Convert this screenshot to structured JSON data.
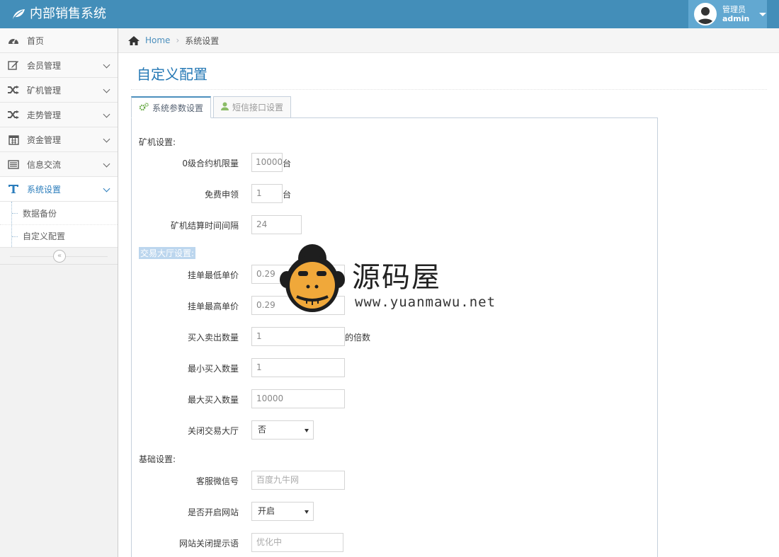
{
  "app": {
    "title": "内部销售系统"
  },
  "user": {
    "role": "管理员",
    "name": "admin"
  },
  "sidebar": {
    "items": [
      {
        "label": "首页",
        "icon": "dashboard-icon"
      },
      {
        "label": "会员管理",
        "icon": "edit-icon"
      },
      {
        "label": "矿机管理",
        "icon": "shuffle-icon"
      },
      {
        "label": "走势管理",
        "icon": "shuffle-icon"
      },
      {
        "label": "资金管理",
        "icon": "calendar-icon"
      },
      {
        "label": "信息交流",
        "icon": "list-icon"
      },
      {
        "label": "系统设置",
        "icon": "text-icon"
      }
    ],
    "submenu": [
      {
        "label": "数据备份"
      },
      {
        "label": "自定义配置"
      }
    ],
    "collapse": "«"
  },
  "breadcrumb": {
    "home": "Home",
    "current": "系统设置"
  },
  "page": {
    "title": "自定义配置"
  },
  "tabs": [
    {
      "label": "系统参数设置",
      "icon": "cogs-icon"
    },
    {
      "label": "短信接口设置",
      "icon": "user-icon"
    }
  ],
  "form": {
    "sections": {
      "miner": "矿机设置:",
      "trade": "交易大厅设置:",
      "basic": "基础设置:"
    },
    "miner_limit": {
      "label": "0级合约机限量",
      "value": "10000",
      "suffix": "台"
    },
    "free_claim": {
      "label": "免费申领",
      "value": "1",
      "suffix": "台"
    },
    "settle_interval": {
      "label": "矿机结算时间间隔",
      "value": "24"
    },
    "min_price": {
      "label": "挂单最低单价",
      "value": "0.29"
    },
    "max_price": {
      "label": "挂单最高单价",
      "value": "0.29"
    },
    "trade_qty": {
      "label": "买入卖出数量",
      "value": "1",
      "suffix": "的倍数"
    },
    "min_buy": {
      "label": "最小买入数量",
      "value": "1"
    },
    "max_buy": {
      "label": "最大买入数量",
      "value": "10000"
    },
    "close_hall": {
      "label": "关闭交易大厅",
      "value": "否"
    },
    "wechat": {
      "label": "客服微信号",
      "value": "百度九牛网"
    },
    "site_open": {
      "label": "是否开启网站",
      "value": "开启"
    },
    "close_msg": {
      "label": "网站关闭提示语",
      "value": "优化中"
    }
  },
  "watermark": {
    "cn": "源码屋",
    "url": "www.yuanmawu.net"
  }
}
